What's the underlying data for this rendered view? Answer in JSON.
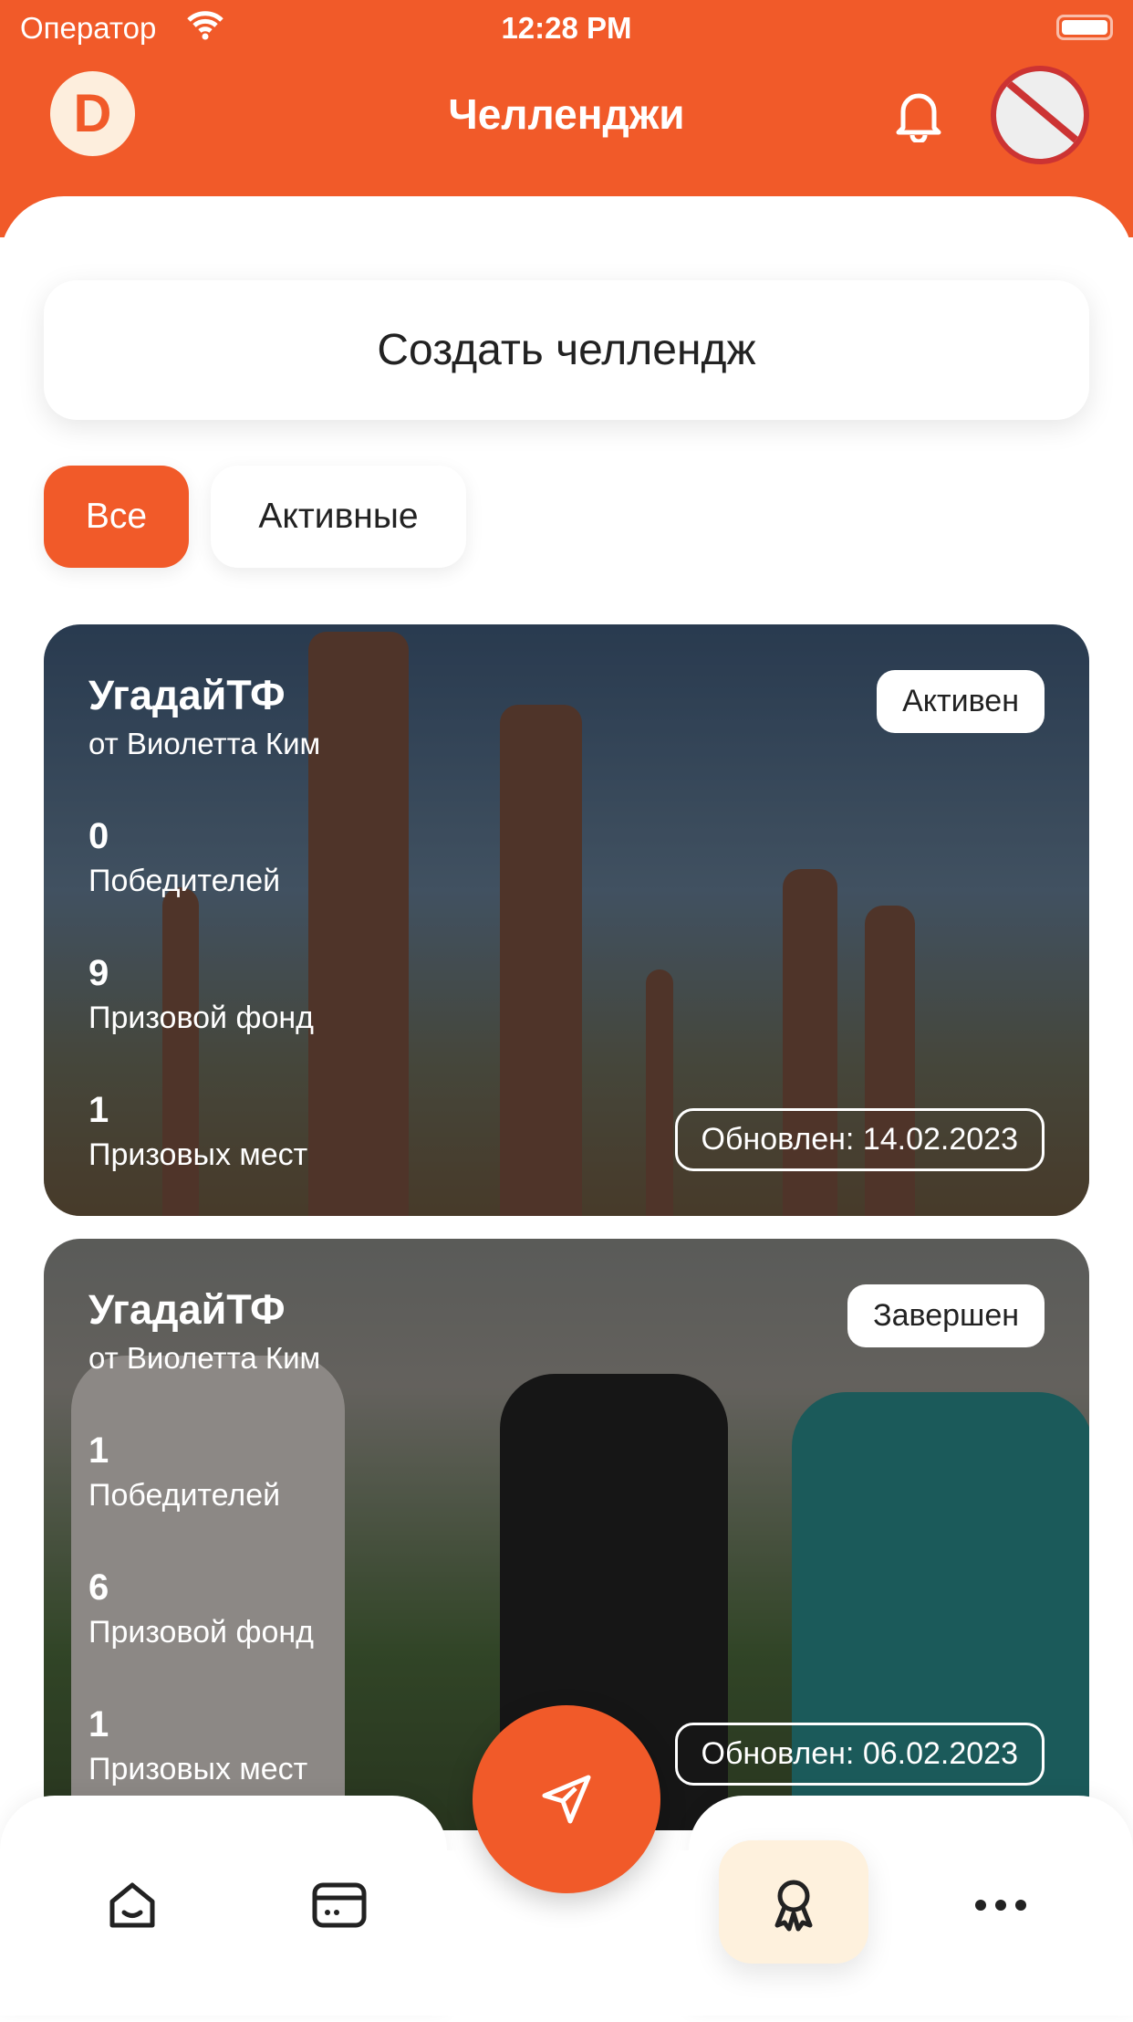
{
  "status_bar": {
    "carrier": "Оператор",
    "time": "12:28 PM"
  },
  "header": {
    "title": "Челленджи",
    "logo_letter": "D"
  },
  "create_button": "Создать челлендж",
  "filters": [
    {
      "label": "Все",
      "selected": true
    },
    {
      "label": "Активные",
      "selected": false
    }
  ],
  "challenges": [
    {
      "title": "УгадайТФ",
      "author": "от Виолетта Ким",
      "status": "Активен",
      "winners": "0",
      "winners_label": "Победителей",
      "prize_fund": "9",
      "prize_fund_label": "Призовой фонд",
      "prize_places": "1",
      "prize_places_label": "Призовых мест",
      "updated": "Обновлен: 14.02.2023"
    },
    {
      "title": "УгадайТФ",
      "author": "от Виолетта Ким",
      "status": "Завершен",
      "winners": "1",
      "winners_label": "Победителей",
      "prize_fund": "6",
      "prize_fund_label": "Призовой фонд",
      "prize_places": "1",
      "prize_places_label": "Призовых мест",
      "updated": "Обновлен: 06.02.2023"
    }
  ],
  "bottom_nav": {
    "items": [
      "home-icon",
      "card-icon",
      "send-icon",
      "award-icon",
      "more-icon"
    ],
    "active": "award-icon"
  },
  "colors": {
    "accent": "#f15a29",
    "active_nav_bg": "#fef1dd"
  }
}
